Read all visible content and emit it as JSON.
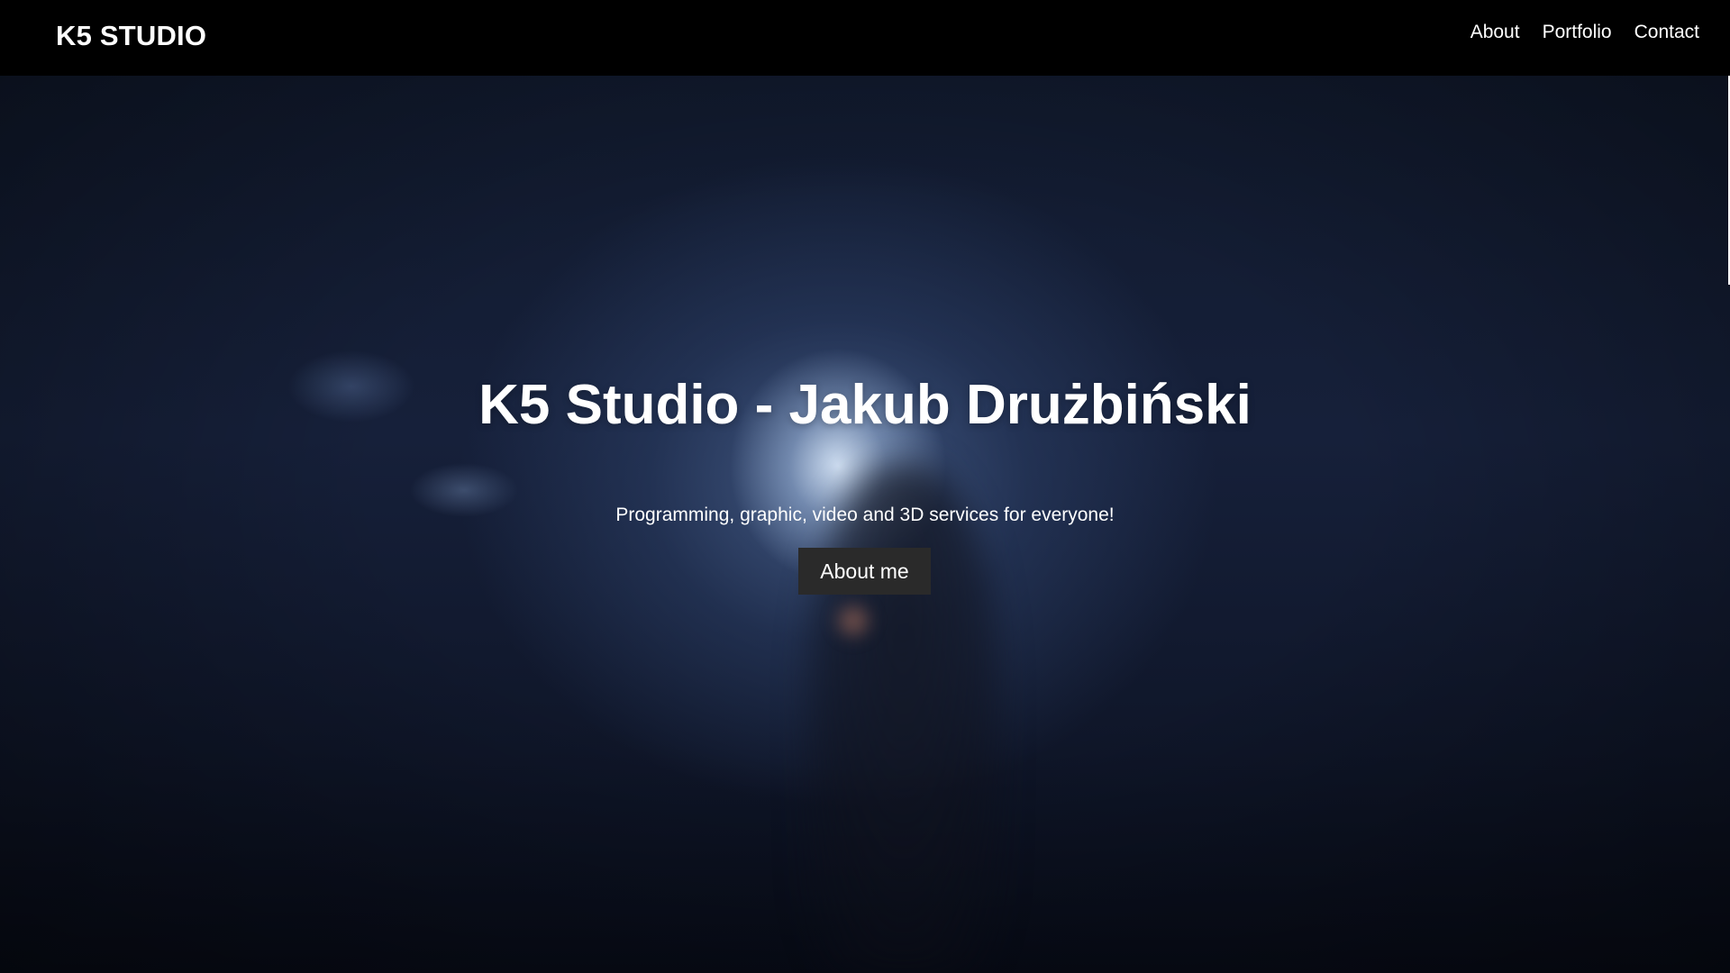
{
  "navbar": {
    "brand": "K5 STUDIO",
    "links": [
      {
        "label": "About"
      },
      {
        "label": "Portfolio"
      },
      {
        "label": "Contact"
      }
    ]
  },
  "hero": {
    "title": "K5 Studio - Jakub Drużbiński",
    "subtitle": "Programming, graphic, video and 3D services for everyone!",
    "button_label": "About me"
  },
  "colors": {
    "navbar_bg": "#000000",
    "hero_bg": "#16203a",
    "button_bg": "#2a2a2a",
    "text": "#ffffff"
  }
}
